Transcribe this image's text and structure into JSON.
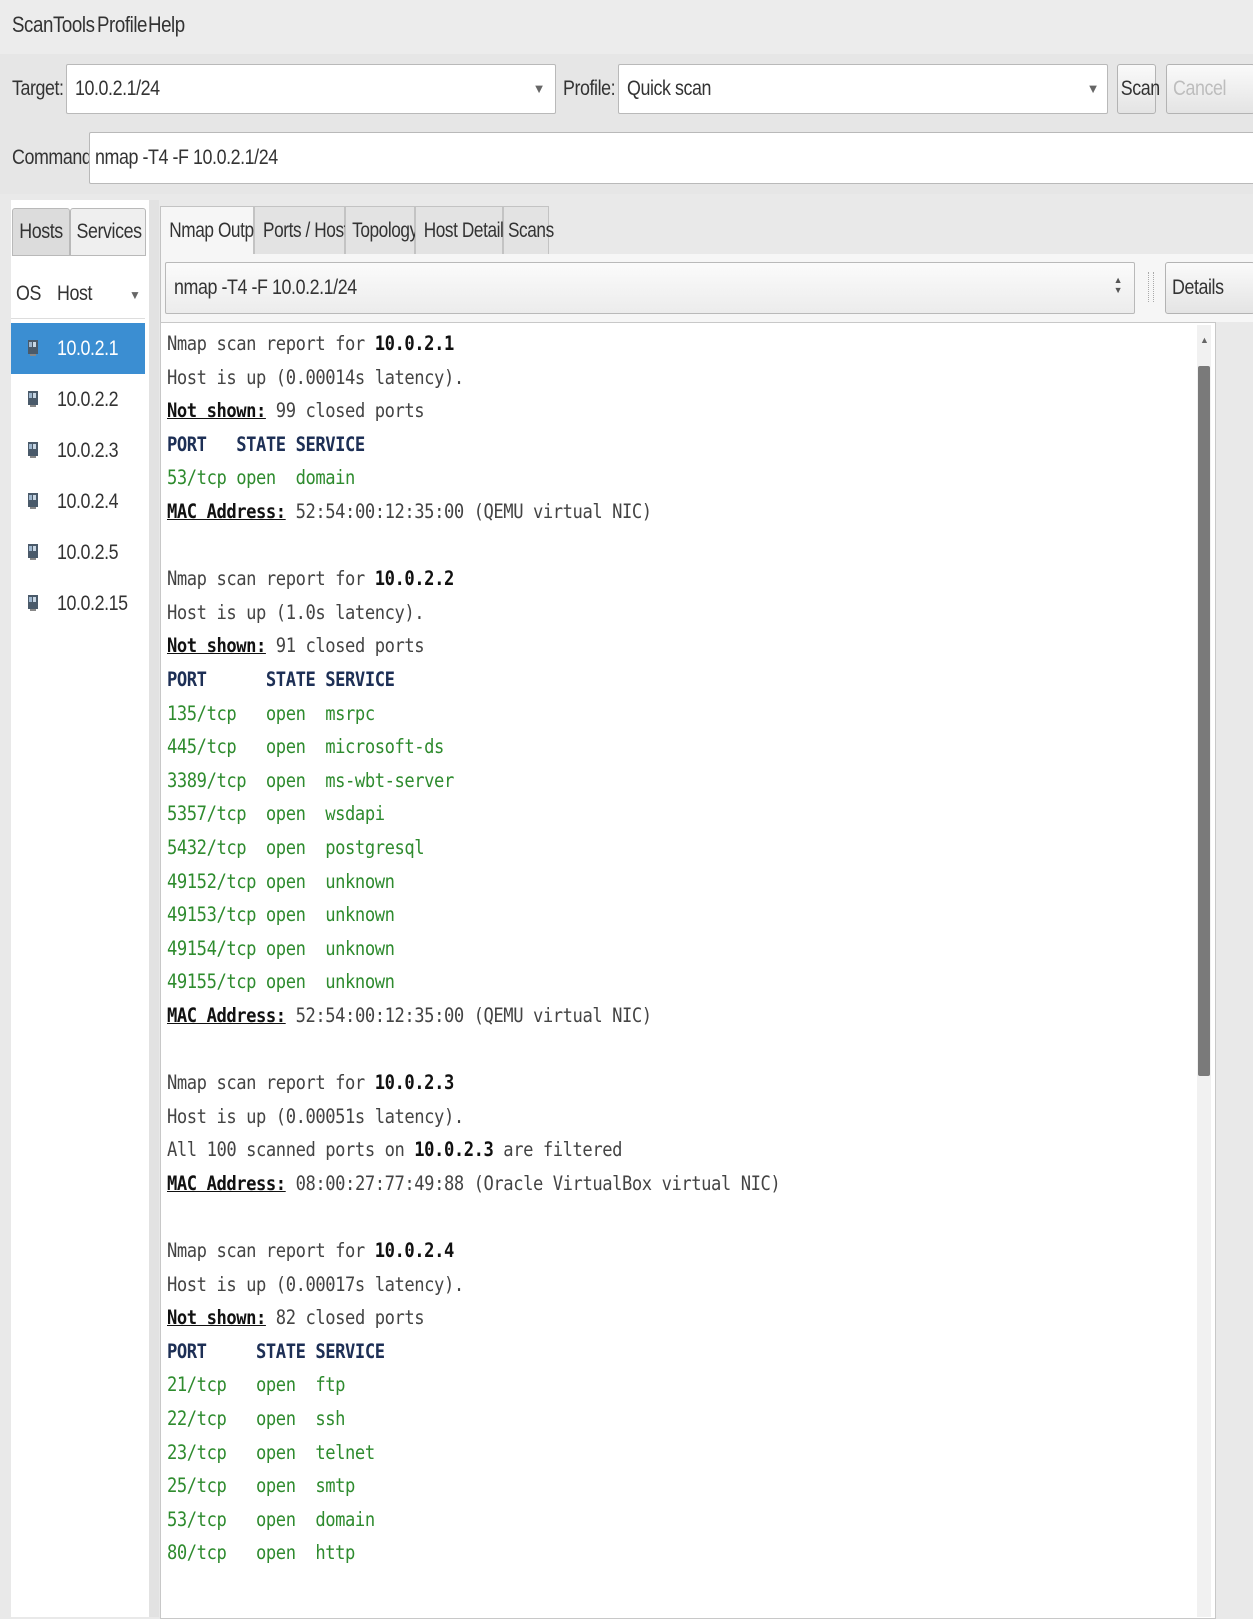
{
  "menu": [
    "Scan",
    "Tools",
    "Profile",
    "Help"
  ],
  "toolbar": {
    "target_label": "Target:",
    "target_value": "10.0.2.1/24",
    "profile_label": "Profile:",
    "profile_value": "Quick scan",
    "scan_label": "Scan",
    "cancel_label": "Cancel",
    "command_label": "Command:",
    "command_value": "nmap -T4 -F 10.0.2.1/24"
  },
  "left": {
    "tabs": [
      "Hosts",
      "Services"
    ],
    "col_os": "OS",
    "col_host": "Host",
    "hosts": [
      "10.0.2.1",
      "10.0.2.2",
      "10.0.2.3",
      "10.0.2.4",
      "10.0.2.5",
      "10.0.2.15"
    ],
    "selected_index": 0
  },
  "right": {
    "tabs": [
      "Nmap Output",
      "Ports / Hosts",
      "Topology",
      "Host Details",
      "Scans"
    ],
    "active_tab": 0,
    "command_select": "nmap -T4 -F 10.0.2.1/24",
    "details_label": "Details"
  },
  "output": [
    {
      "t": "report",
      "pre": "Nmap scan report for ",
      "ip": "10.0.2.1"
    },
    {
      "t": "plain",
      "text": "Host is up (0.00014s latency)."
    },
    {
      "t": "notshown",
      "label": "Not shown:",
      "rest": " 99 closed ports"
    },
    {
      "t": "header",
      "text": "PORT   STATE SERVICE"
    },
    {
      "t": "port",
      "text": "53/tcp open  domain"
    },
    {
      "t": "mac",
      "label": "MAC Address:",
      "rest": " 52:54:00:12:35:00 (QEMU virtual NIC)"
    },
    {
      "t": "blank"
    },
    {
      "t": "report",
      "pre": "Nmap scan report for ",
      "ip": "10.0.2.2"
    },
    {
      "t": "plain",
      "text": "Host is up (1.0s latency)."
    },
    {
      "t": "notshown",
      "label": "Not shown:",
      "rest": " 91 closed ports"
    },
    {
      "t": "header",
      "text": "PORT      STATE SERVICE"
    },
    {
      "t": "port",
      "text": "135/tcp   open  msrpc"
    },
    {
      "t": "port",
      "text": "445/tcp   open  microsoft-ds"
    },
    {
      "t": "port",
      "text": "3389/tcp  open  ms-wbt-server"
    },
    {
      "t": "port",
      "text": "5357/tcp  open  wsdapi"
    },
    {
      "t": "port",
      "text": "5432/tcp  open  postgresql"
    },
    {
      "t": "port",
      "text": "49152/tcp open  unknown"
    },
    {
      "t": "port",
      "text": "49153/tcp open  unknown"
    },
    {
      "t": "port",
      "text": "49154/tcp open  unknown"
    },
    {
      "t": "port",
      "text": "49155/tcp open  unknown"
    },
    {
      "t": "mac",
      "label": "MAC Address:",
      "rest": " 52:54:00:12:35:00 (QEMU virtual NIC)"
    },
    {
      "t": "blank"
    },
    {
      "t": "report",
      "pre": "Nmap scan report for ",
      "ip": "10.0.2.3"
    },
    {
      "t": "plain",
      "text": "Host is up (0.00051s latency)."
    },
    {
      "t": "filtered",
      "pre": "All 100 scanned ports on ",
      "ip": "10.0.2.3",
      "post": " are filtered"
    },
    {
      "t": "mac",
      "label": "MAC Address:",
      "rest": " 08:00:27:77:49:88 (Oracle VirtualBox virtual NIC)"
    },
    {
      "t": "blank"
    },
    {
      "t": "report",
      "pre": "Nmap scan report for ",
      "ip": "10.0.2.4"
    },
    {
      "t": "plain",
      "text": "Host is up (0.00017s latency)."
    },
    {
      "t": "notshown",
      "label": "Not shown:",
      "rest": " 82 closed ports"
    },
    {
      "t": "header",
      "text": "PORT     STATE SERVICE"
    },
    {
      "t": "port",
      "text": "21/tcp   open  ftp"
    },
    {
      "t": "port",
      "text": "22/tcp   open  ssh"
    },
    {
      "t": "port",
      "text": "23/tcp   open  telnet"
    },
    {
      "t": "port",
      "text": "25/tcp   open  smtp"
    },
    {
      "t": "port",
      "text": "53/tcp   open  domain"
    },
    {
      "t": "port",
      "text": "80/tcp   open  http"
    }
  ],
  "colors": {
    "selection": "#3b8ed2",
    "port_green": "#2e8b2e",
    "header_navy": "#1d2f55"
  }
}
